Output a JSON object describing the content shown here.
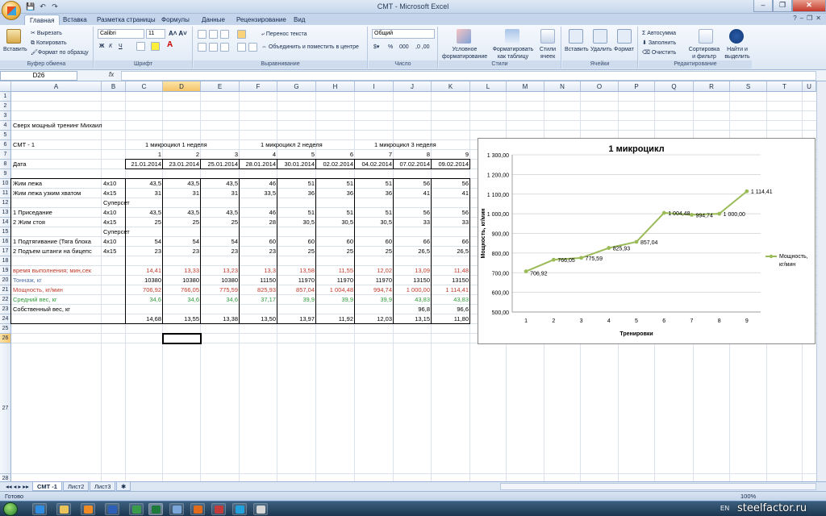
{
  "window": {
    "title": "СМТ - Microsoft Excel",
    "minimize": "–",
    "restore": "❐",
    "close": "✕"
  },
  "qat": {
    "save": "💾",
    "undo": "↶",
    "redo": "↷"
  },
  "tabs": [
    "Главная",
    "Вставка",
    "Разметка страницы",
    "Формулы",
    "Данные",
    "Рецензирование",
    "Вид"
  ],
  "help": {
    "icon": "?",
    "min": "–",
    "restore": "❐",
    "close": "✕"
  },
  "ribbon": {
    "clipboard": {
      "label": "Буфер обмена",
      "paste": "Вставить",
      "cut": "Вырезать",
      "copy": "Копировать",
      "format_painter": "Формат по образцу"
    },
    "font": {
      "label": "Шрифт",
      "name": "Calibri",
      "size": "11",
      "bold": "Ж",
      "italic": "К",
      "underline": "Ч"
    },
    "alignment": {
      "label": "Выравнивание",
      "wrap": "Перенос текста",
      "merge": "Объединить и поместить в центре"
    },
    "number": {
      "label": "Число",
      "format": "Общий",
      "percent": "%",
      "thousands": "000"
    },
    "styles": {
      "label": "Стили",
      "conditional": "Условное форматирование",
      "as_table": "Форматировать как таблицу",
      "cell_styles": "Стили ячеек"
    },
    "cells": {
      "label": "Ячейки",
      "insert": "Вставить",
      "delete": "Удалить",
      "format": "Формат"
    },
    "editing": {
      "label": "Редактирование",
      "autosum": "Автосумма",
      "fill": "Заполнить",
      "clear": "Очистить",
      "sort": "Сортировка и фильтр",
      "find": "Найти и выделить"
    }
  },
  "formula_bar": {
    "name_box": "D26",
    "fx": "fx",
    "value": ""
  },
  "columns": [
    "A",
    "B",
    "C",
    "D",
    "E",
    "F",
    "G",
    "H",
    "I",
    "J",
    "K",
    "L",
    "M",
    "N",
    "O",
    "P",
    "Q",
    "R",
    "S",
    "T",
    "U"
  ],
  "selected_col": "D",
  "rows": [
    "1",
    "2",
    "3",
    "4",
    "5",
    "6",
    "7",
    "8",
    "9",
    "10",
    "11",
    "12",
    "13",
    "14",
    "15",
    "16",
    "17",
    "18",
    "19",
    "20",
    "21",
    "22",
    "23",
    "24",
    "25",
    "26",
    "27",
    "28"
  ],
  "selected_row": "26",
  "sheet": {
    "r4": "Сверх мощный тренинг  Михаил",
    "r6": {
      "a": "СМТ - 1",
      "m1": "1  микроцикл 1 неделя",
      "m2": "1  микроцикл 2 неделя",
      "m3": "1  микроцикл 3 неделя"
    },
    "r7": [
      "1",
      "2",
      "3",
      "4",
      "5",
      "6",
      "7",
      "8",
      "9"
    ],
    "r8": {
      "a": "Дата",
      "dates": [
        "21.01.2014",
        "23.01.2014",
        "25.01.2014",
        "28.01.2014",
        "30.01.2014",
        "02.02.2014",
        "04.02.2014",
        "07.02.2014",
        "09.02.2014"
      ]
    },
    "r10": {
      "a": "Жим лежа",
      "b": "4x10",
      "v": [
        "43,5",
        "43,5",
        "43,5",
        "46",
        "51",
        "51",
        "51",
        "56",
        "56"
      ]
    },
    "r11": {
      "a": "Жим лежа узким хватом",
      "b": "4x15",
      "v": [
        "31",
        "31",
        "31",
        "33,5",
        "36",
        "36",
        "36",
        "41",
        "41"
      ]
    },
    "r12": "Суперсет",
    "r13": {
      "a": "1  Приседание",
      "b": "4x10",
      "v": [
        "43,5",
        "43,5",
        "43,5",
        "46",
        "51",
        "51",
        "51",
        "56",
        "56"
      ]
    },
    "r14": {
      "a": "2  Жим стоя",
      "b": "4x15",
      "v": [
        "25",
        "25",
        "25",
        "28",
        "30,5",
        "30,5",
        "30,5",
        "33",
        "33"
      ]
    },
    "r15": "Суперсет",
    "r16": {
      "a": "1 Подтягивание (Тяга блока",
      "b": "4x10",
      "v": [
        "54",
        "54",
        "54",
        "60",
        "60",
        "60",
        "60",
        "66",
        "66"
      ]
    },
    "r17": {
      "a": "2 Подъем штанги на бицепс",
      "b": "4x15",
      "v": [
        "23",
        "23",
        "23",
        "23",
        "25",
        "25",
        "25",
        "26,5",
        "26,5"
      ]
    },
    "r19": {
      "a": "время выполнения; мин,сек",
      "v": [
        "14,41",
        "13,33",
        "13,23",
        "13,3",
        "13,58",
        "11,55",
        "12,02",
        "13,09",
        "11,48"
      ]
    },
    "r20": {
      "a": "Тоннаж, кг",
      "v": [
        "10380",
        "10380",
        "10380",
        "11150",
        "11970",
        "11970",
        "11970",
        "13150",
        "13150"
      ]
    },
    "r21": {
      "a": "Мощность, кг/мин",
      "v": [
        "706,92",
        "766,05",
        "775,59",
        "825,93",
        "857,04",
        "1 004,48",
        "994,74",
        "1 000,00",
        "1 114,41"
      ]
    },
    "r22": {
      "a": "Средний вес, кг",
      "v": [
        "34,6",
        "34,6",
        "34,6",
        "37,17",
        "39,9",
        "39,9",
        "39,9",
        "43,83",
        "43,83"
      ]
    },
    "r23": {
      "a": "Собственный вес, кг",
      "v": [
        "",
        "",
        "",
        "",
        "",
        "",
        "",
        "96,8",
        "96,6"
      ]
    },
    "r24": {
      "v": [
        "14,68",
        "13,55",
        "13,38",
        "13,50",
        "13,97",
        "11,92",
        "12,03",
        "13,15",
        "11,80"
      ]
    }
  },
  "chart_data": {
    "type": "line",
    "title": "1 микроцикл",
    "xlabel": "Тренировки",
    "ylabel": "Мощность, кг/мин",
    "categories": [
      "1",
      "2",
      "3",
      "4",
      "5",
      "6",
      "7",
      "8",
      "9"
    ],
    "series": [
      {
        "name": "Мощность, кг/мин",
        "values": [
          706.92,
          766.05,
          775.59,
          825.93,
          857.04,
          1004.48,
          994.74,
          1000.0,
          1114.41
        ],
        "labels": [
          "706,92",
          "766,05",
          "775,59",
          "825,93",
          "857,04",
          "1 004,48",
          "994,74",
          "1 000,00",
          "1 114,41"
        ],
        "color": "#9bbb59"
      }
    ],
    "ylim": [
      500,
      1300
    ],
    "yticks": [
      "500,00",
      "600,00",
      "700,00",
      "800,00",
      "900,00",
      "1 000,00",
      "1 100,00",
      "1 200,00",
      "1 300,00"
    ],
    "grid": true,
    "legend": "right"
  },
  "sheet_tabs": [
    "СМТ -1",
    "Лист2",
    "Лист3"
  ],
  "status": {
    "ready": "Готово",
    "zoom": "100%"
  },
  "taskbar": {
    "lang": "EN"
  },
  "watermark": "steelfactor.ru"
}
